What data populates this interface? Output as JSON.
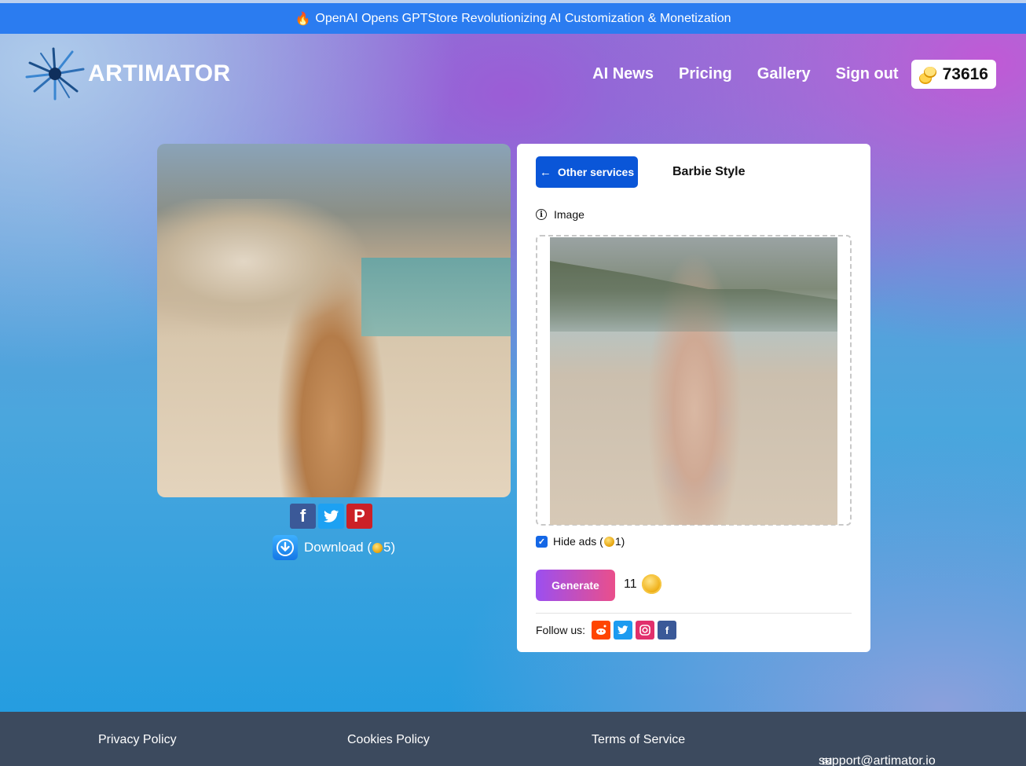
{
  "announcement": {
    "icon": "fire-icon",
    "text": "OpenAI Opens GPTStore Revolutionizing AI Customization & Monetization"
  },
  "brand": {
    "name": "ARTIMATOR"
  },
  "nav": {
    "items": [
      "AI News",
      "Pricing",
      "Gallery",
      "Sign out"
    ],
    "credits": "73616"
  },
  "result": {
    "share": [
      {
        "name": "facebook",
        "glyph": "f",
        "color": "#3b5998"
      },
      {
        "name": "twitter",
        "glyph": "t",
        "color": "#1da1f2"
      },
      {
        "name": "pinterest",
        "glyph": "P",
        "color": "#cb2027"
      }
    ],
    "download_label": "Download (",
    "download_cost": "5)"
  },
  "panel": {
    "back_label": "Other services",
    "service_title": "Barbie Style",
    "image_label": "Image",
    "hide_ads_label": "Hide ads (",
    "hide_ads_cost": "1)",
    "hide_ads_checked": true,
    "generate_label": "Generate",
    "generate_cost": "11",
    "follow_label": "Follow us:",
    "socials": [
      {
        "name": "reddit",
        "glyph": "r",
        "color": "#ff4500"
      },
      {
        "name": "twitter",
        "glyph": "t",
        "color": "#1d9bf0"
      },
      {
        "name": "instagram",
        "glyph": "◎",
        "color": "#e1306c"
      },
      {
        "name": "facebook",
        "glyph": "f",
        "color": "#3b5998"
      }
    ]
  },
  "footer": {
    "privacy": "Privacy Policy",
    "cookies": "Cookies Policy",
    "terms": "Terms of Service",
    "support": "support@artimator.io"
  },
  "colors": {
    "primary_blue": "#0a56d8",
    "generate_gradient_start": "#9b4ff0",
    "generate_gradient_end": "#ea4f8b",
    "footer": "#3c4a5e"
  }
}
